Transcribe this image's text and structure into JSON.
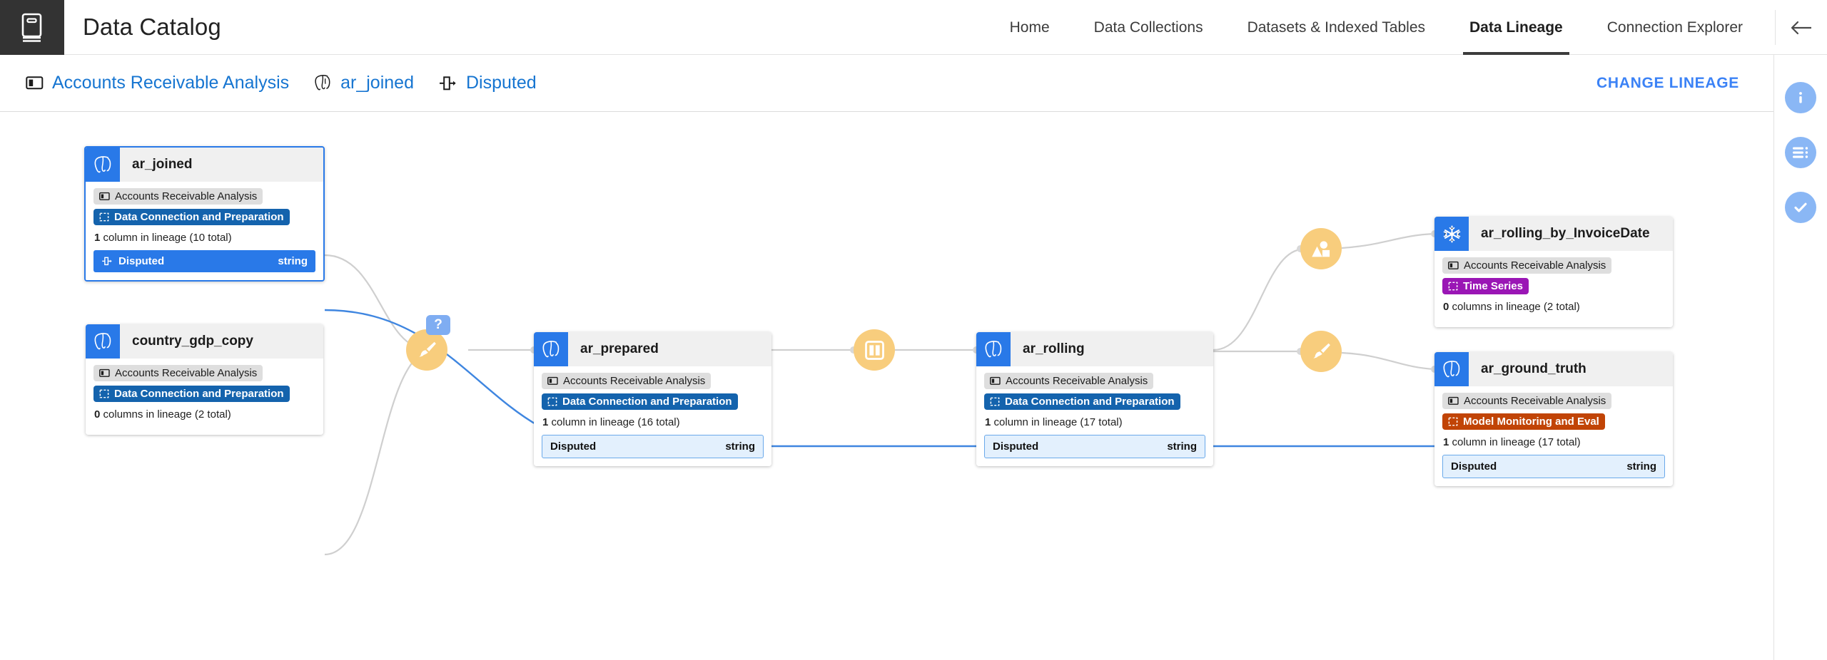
{
  "header": {
    "logo_icon": "catalog-book-icon",
    "app_title": "Data Catalog",
    "nav": [
      {
        "label": "Home",
        "active": false
      },
      {
        "label": "Data Collections",
        "active": false
      },
      {
        "label": "Datasets & Indexed Tables",
        "active": false
      },
      {
        "label": "Data Lineage",
        "active": true
      },
      {
        "label": "Connection Explorer",
        "active": false
      }
    ],
    "collapse_icon": "arrow-left-icon"
  },
  "breadcrumb": {
    "items": [
      {
        "label": "Accounts Receivable Analysis",
        "icon": "collection-icon"
      },
      {
        "label": "ar_joined",
        "icon": "postgresql-icon"
      },
      {
        "label": "Disputed",
        "icon": "column-icon"
      }
    ],
    "action_label": "CHANGE LINEAGE"
  },
  "rail": {
    "buttons": [
      {
        "icon": "info-icon",
        "color": "#8ab7f5"
      },
      {
        "icon": "details-list-icon",
        "color": "#8ab7f5"
      },
      {
        "icon": "check-circle-icon",
        "color": "#8ab7f5"
      }
    ]
  },
  "graph": {
    "nodes": [
      {
        "id": "ar_joined",
        "title": "ar_joined",
        "source_icon": "postgresql-icon",
        "selected": true,
        "collection": "Accounts Receivable Analysis",
        "stage": {
          "label": "Data Connection and Preparation",
          "kind": "dcp"
        },
        "lineage_count_bold": "1",
        "lineage_count_rest": "column in lineage (10 total)",
        "columns": [
          {
            "name": "Disputed",
            "type": "string",
            "state": "selected",
            "icon": "column-icon"
          }
        ]
      },
      {
        "id": "country_gdp_copy",
        "title": "country_gdp_copy",
        "source_icon": "postgresql-icon",
        "selected": false,
        "collection": "Accounts Receivable Analysis",
        "stage": {
          "label": "Data Connection and Preparation",
          "kind": "dcp"
        },
        "lineage_count_bold": "0",
        "lineage_count_rest": "columns in lineage (2 total)",
        "columns": []
      },
      {
        "id": "ar_prepared",
        "title": "ar_prepared",
        "source_icon": "postgresql-icon",
        "selected": false,
        "collection": "Accounts Receivable Analysis",
        "stage": {
          "label": "Data Connection and Preparation",
          "kind": "dcp"
        },
        "lineage_count_bold": "1",
        "lineage_count_rest": "column in lineage (16 total)",
        "columns": [
          {
            "name": "Disputed",
            "type": "string",
            "state": "highlight",
            "icon": ""
          }
        ]
      },
      {
        "id": "ar_rolling",
        "title": "ar_rolling",
        "source_icon": "postgresql-icon",
        "selected": false,
        "collection": "Accounts Receivable Analysis",
        "stage": {
          "label": "Data Connection and Preparation",
          "kind": "dcp"
        },
        "lineage_count_bold": "1",
        "lineage_count_rest": "column in lineage (17 total)",
        "columns": [
          {
            "name": "Disputed",
            "type": "string",
            "state": "highlight",
            "icon": ""
          }
        ]
      },
      {
        "id": "ar_rolling_by_InvoiceDate",
        "title": "ar_rolling_by_InvoiceDate",
        "source_icon": "snowflake-icon",
        "selected": false,
        "collection": "Accounts Receivable Analysis",
        "stage": {
          "label": "Time Series",
          "kind": "ts"
        },
        "lineage_count_bold": "0",
        "lineage_count_rest": "columns in lineage (2 total)",
        "columns": []
      },
      {
        "id": "ar_ground_truth",
        "title": "ar_ground_truth",
        "source_icon": "postgresql-icon",
        "selected": false,
        "collection": "Accounts Receivable Analysis",
        "stage": {
          "label": "Model Monitoring and Eval",
          "kind": "mme"
        },
        "lineage_count_bold": "1",
        "lineage_count_rest": "column in lineage (17 total)",
        "columns": [
          {
            "name": "Disputed",
            "type": "string",
            "state": "highlight",
            "icon": ""
          }
        ]
      }
    ],
    "operations": [
      {
        "id": "op-clean-1",
        "icon": "paintbrush-icon",
        "badge": "?"
      },
      {
        "id": "op-columns-1",
        "icon": "columns-icon",
        "badge": ""
      },
      {
        "id": "op-shapes-1",
        "icon": "shapes-icon",
        "badge": ""
      },
      {
        "id": "op-clean-2",
        "icon": "paintbrush-icon",
        "badge": ""
      }
    ],
    "colors": {
      "accent_blue": "#2979e8",
      "edge_gray": "#cfcfcf",
      "edge_blue": "#3f86e0",
      "op_orange": "#f8cd7d"
    }
  }
}
